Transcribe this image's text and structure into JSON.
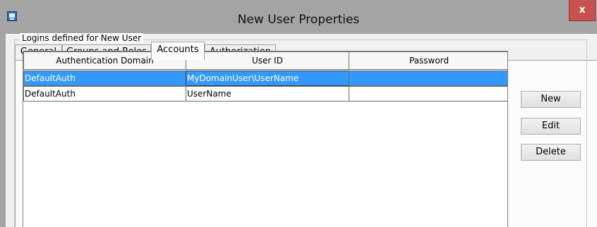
{
  "window": {
    "title": "New User Properties",
    "close_label": "x"
  },
  "tabs": [
    {
      "label": "General"
    },
    {
      "label": "Groups and Roles"
    },
    {
      "label": "Accounts",
      "active": true
    },
    {
      "label": "Authorization"
    }
  ],
  "logins": {
    "group_label": "Logins defined for New User",
    "columns": [
      "Authentication Domain",
      "User ID",
      "Password"
    ],
    "rows": [
      {
        "domain": "DefaultAuth",
        "user_id": "MyDomainUser\\UserName",
        "password": "",
        "selected": true
      },
      {
        "domain": "DefaultAuth",
        "user_id": "UserName",
        "password": ""
      }
    ]
  },
  "buttons": {
    "new_label": "New",
    "edit_label": "Edit",
    "delete_label": "Delete"
  },
  "colors": {
    "selection": "#3399ff",
    "close_button": "#c75050",
    "title_bar": "#a4a4a4"
  }
}
